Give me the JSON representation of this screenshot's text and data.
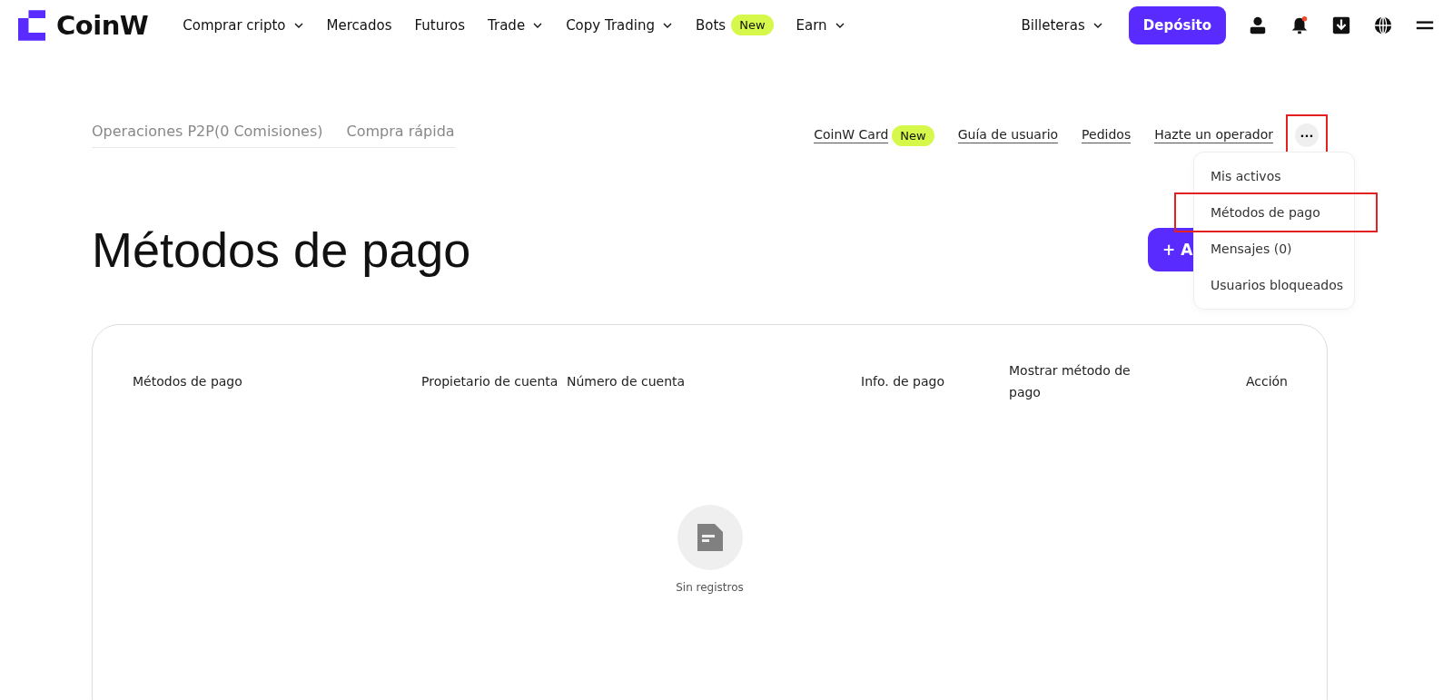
{
  "brand": {
    "name": "CoinW"
  },
  "nav": [
    {
      "label": "Comprar cripto",
      "dropdown": true
    },
    {
      "label": "Mercados",
      "dropdown": false
    },
    {
      "label": "Futuros",
      "dropdown": false
    },
    {
      "label": "Trade",
      "dropdown": true
    },
    {
      "label": "Copy Trading",
      "dropdown": true
    },
    {
      "label": "Bots",
      "dropdown": false,
      "badge": "New"
    },
    {
      "label": "Earn",
      "dropdown": true
    }
  ],
  "wallets": {
    "label": "Billeteras",
    "dropdown": true
  },
  "deposit_button": "Depósito",
  "notification_dot": true,
  "p2p_tabs": [
    {
      "label": "Operaciones P2P(0 Comisiones)",
      "selected": false
    },
    {
      "label": "Compra rápida",
      "selected": false
    }
  ],
  "p2p_links": [
    {
      "label": "CoinW Card",
      "badge": "New"
    },
    {
      "label": "Guía de usuario"
    },
    {
      "label": "Pedidos"
    },
    {
      "label": "Hazte un operador"
    }
  ],
  "more_button": {
    "label": "···",
    "highlighted": true
  },
  "more_menu": [
    {
      "label": "Mis activos",
      "highlighted": false
    },
    {
      "label": "Métodos de pago",
      "highlighted": true
    },
    {
      "label": "Mensajes (0)",
      "highlighted": false
    },
    {
      "label": "Usuarios bloqueados",
      "highlighted": false
    }
  ],
  "page_title": "Métodos de pago",
  "add_button": "+ A",
  "table": {
    "columns": [
      "Métodos de pago",
      "Propietario de cuenta",
      "Número de cuenta",
      "Info. de pago",
      "Mostrar método de pago",
      "Acción"
    ],
    "empty_text": "Sin registros"
  }
}
